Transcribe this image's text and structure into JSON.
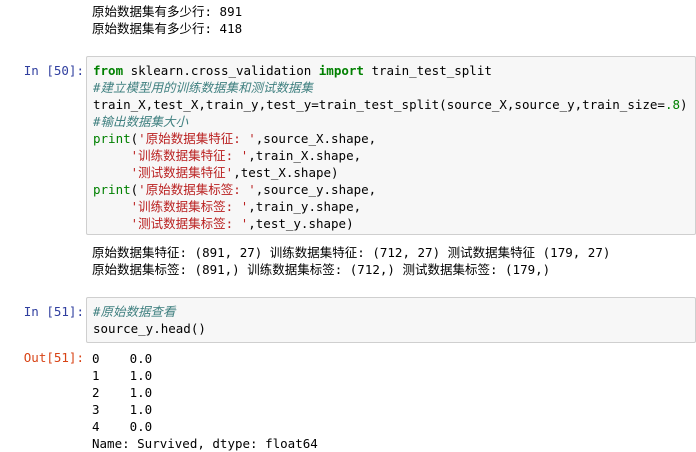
{
  "top_output": [
    "原始数据集有多少行: 891",
    "原始数据集有多少行: 418"
  ],
  "cell50": {
    "prompt": "In [50]:",
    "import_kw_from": "from",
    "import_module": " sklearn.cross_validation ",
    "import_kw_import": "import",
    "import_name": " train_test_split",
    "comment1": "#建立模型用的训练数据集和测试数据集",
    "split_line_a": "train_X,test_X,train_y,test_y=train_test_split(source_X,source_y,train_size=",
    "split_line_num": ".8",
    "split_line_b": ")",
    "comment2": "#输出数据集大小",
    "print_kw": "print",
    "p1_str": "'原始数据集特征: '",
    "p1_rest": ",source_X.shape,",
    "p2_str": "'训练数据集特征: '",
    "p2_rest": ",train_X.shape,",
    "p3_str": "'测试数据集特征'",
    "p3_rest": ",test_X.shape)",
    "p4_str": "'原始数据集标签: '",
    "p4_rest": ",source_y.shape,",
    "p5_str": "'训练数据集标签: '",
    "p5_rest": ",train_y.shape,",
    "p6_str": "'测试数据集标签: '",
    "p6_rest": ",test_y.shape)",
    "output": [
      "原始数据集特征: (891, 27) 训练数据集特征: (712, 27) 测试数据集特征 (179, 27)",
      "原始数据集标签: (891,) 训练数据集标签: (712,) 测试数据集标签: (179,)"
    ]
  },
  "cell51": {
    "prompt": "In [51]:",
    "comment": "#原始数据查看",
    "code": "source_y.head()",
    "out_prompt": "Out[51]:",
    "output": [
      "0    0.0",
      "1    1.0",
      "2    1.0",
      "3    1.0",
      "4    0.0",
      "Name: Survived, dtype: float64"
    ]
  }
}
